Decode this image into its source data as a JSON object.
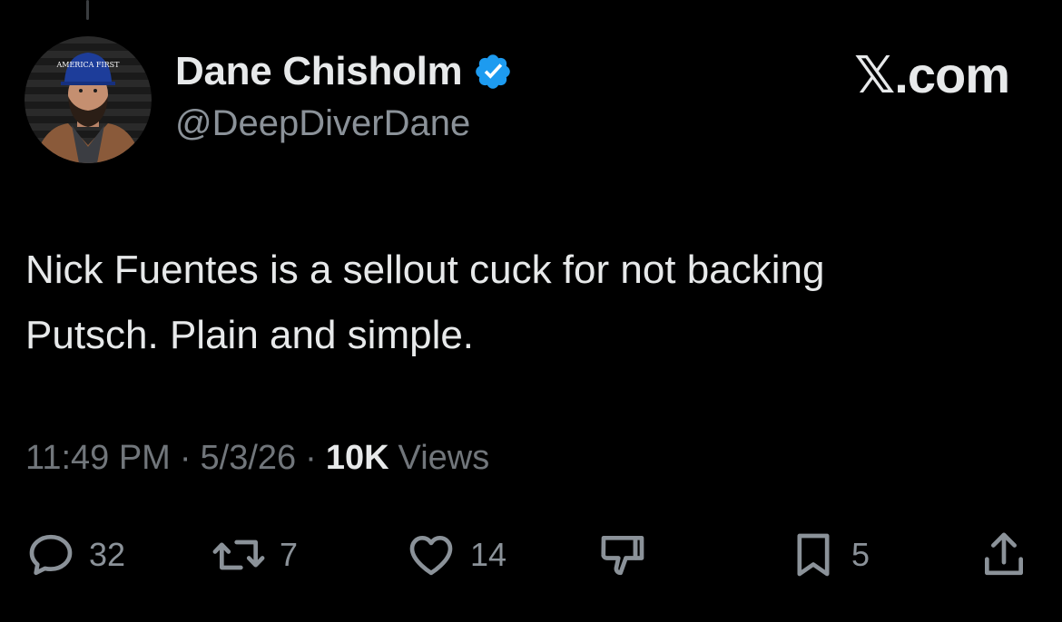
{
  "author": {
    "display_name": "Dane Chisholm",
    "handle": "@DeepDiverDane",
    "verified": true,
    "avatar_cap_text": "AMERICA FIRST"
  },
  "brand": "𝕏.com",
  "tweet": {
    "text": "Nick Fuentes is a sellout cuck for not backing\nPutsch. Plain and simple."
  },
  "meta": {
    "time": "11:49 PM",
    "date": "5/3/26",
    "separator": "·",
    "views_count": "10K",
    "views_label": "Views"
  },
  "actions": {
    "reply_count": "32",
    "repost_count": "7",
    "like_count": "14",
    "bookmark_count": "5",
    "icons": [
      "reply-icon",
      "repost-icon",
      "like-icon",
      "dislike-icon",
      "bookmark-icon",
      "share-icon"
    ]
  },
  "colors": {
    "background": "#000000",
    "primary_text": "#e7e9ea",
    "secondary_text": "#71767b",
    "verified_blue": "#1d9bf0"
  }
}
